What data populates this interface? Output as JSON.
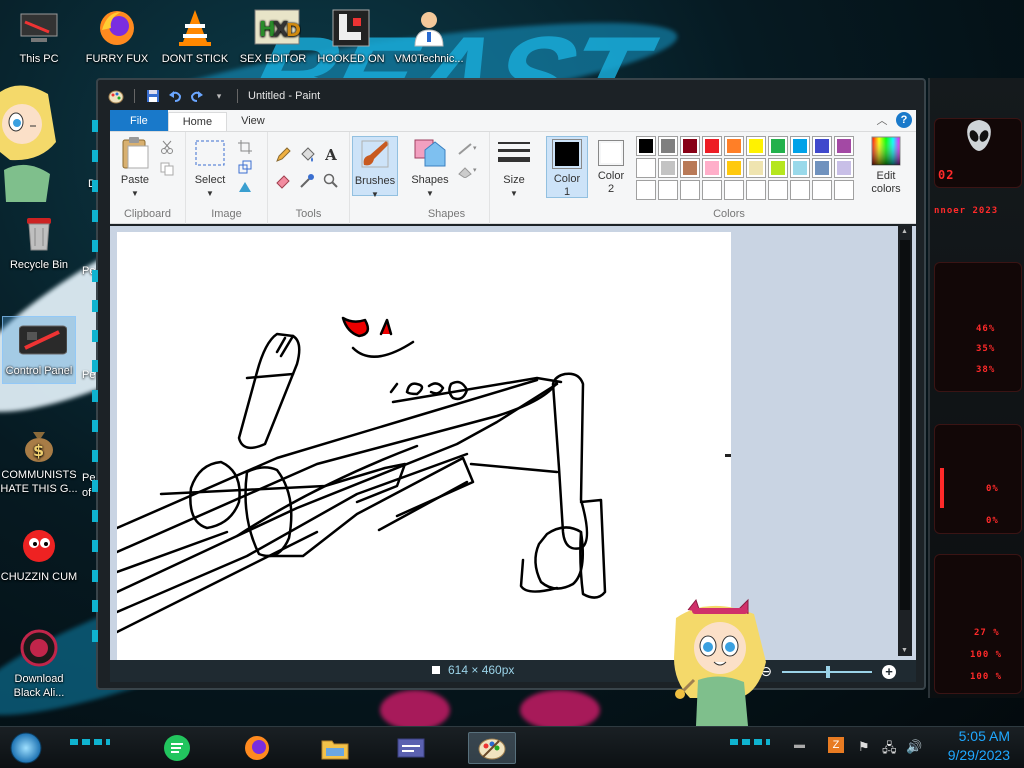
{
  "desktop": {
    "icons": [
      {
        "label": "This PC"
      },
      {
        "label": "FURRY FUX"
      },
      {
        "label": "DONT STICK"
      },
      {
        "label": "SEX EDITOR"
      },
      {
        "label": "HOOKED ON"
      },
      {
        "label": "VM0Technic..."
      },
      {
        "label": "Recycle Bin"
      },
      {
        "label": "Control Panel"
      },
      {
        "label": "COMMUNISTS HATE THIS G..."
      },
      {
        "label": "CHUZZIN CUM"
      },
      {
        "label": "Download Black Ali..."
      }
    ],
    "partial_labels": [
      "Pe",
      "Pe",
      "Pe",
      "of",
      "D"
    ]
  },
  "widget": {
    "lines": [
      "02",
      "nnoer 2023",
      "46%",
      "35%",
      "38%",
      "0%",
      "0%",
      "27 %",
      "100 %",
      "100 %"
    ],
    "accent": "#ff2a2a"
  },
  "paint": {
    "title": "Untitled - Paint",
    "tabs": {
      "file": "File",
      "home": "Home",
      "view": "View"
    },
    "groups": {
      "clipboard": {
        "label": "Clipboard",
        "paste": "Paste"
      },
      "image": {
        "label": "Image",
        "select": "Select"
      },
      "tools": {
        "label": "Tools"
      },
      "brushes": {
        "label": "Brushes"
      },
      "shapes": {
        "label": "Shapes",
        "shapes_btn": "Shapes"
      },
      "size": {
        "label": "Size"
      },
      "colors": {
        "label": "Colors",
        "color1": "Color 1",
        "color2": "Color 2",
        "edit": "Edit colors",
        "palette_row1": [
          "#000000",
          "#7f7f7f",
          "#880015",
          "#ed1c24",
          "#ff7f27",
          "#fff200",
          "#22b14c",
          "#00a2e8",
          "#3f48cc",
          "#a349a4"
        ],
        "palette_row2": [
          "#ffffff",
          "#c3c3c3",
          "#b97a57",
          "#ffaec9",
          "#ffc90e",
          "#efe4b0",
          "#b5e61d",
          "#99d9ea",
          "#7092be",
          "#c8bfe7"
        ],
        "color1_value": "#000000",
        "color2_value": "#ffffff"
      }
    },
    "status": {
      "dimensions": "614 × 460px"
    }
  },
  "taskbar": {
    "time": "5:05 AM",
    "date": "9/29/2023"
  }
}
